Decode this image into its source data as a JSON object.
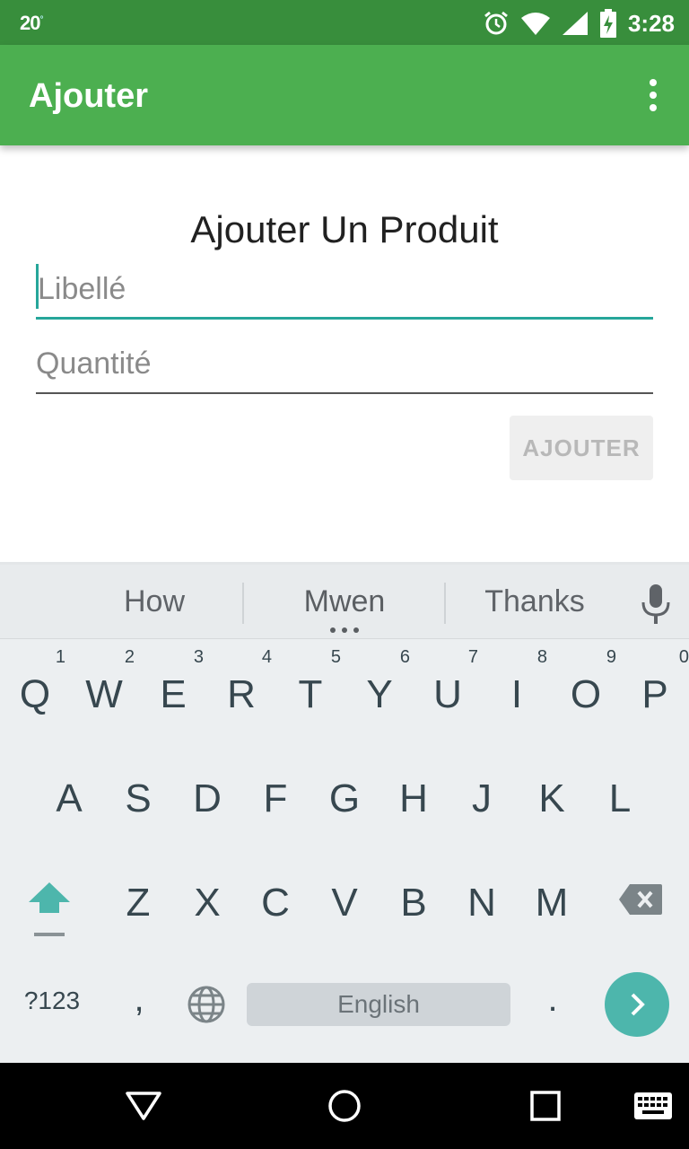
{
  "status_bar": {
    "temperature": "20",
    "degree": "°",
    "time": "3:28",
    "icons": [
      "alarm-icon",
      "wifi-icon",
      "signal-icon",
      "battery-charging-icon"
    ]
  },
  "app_bar": {
    "title": "Ajouter",
    "menu_icon": "more-vertical-icon"
  },
  "form": {
    "heading": "Ajouter Un Produit",
    "libelle": {
      "value": "",
      "placeholder": "Libellé"
    },
    "quantite": {
      "value": "",
      "placeholder": "Quantité"
    },
    "submit_label": "AJOUTER"
  },
  "keyboard": {
    "suggestions": [
      "How",
      "Mwen",
      "Thanks"
    ],
    "row1": [
      {
        "key": "Q",
        "hint": "1"
      },
      {
        "key": "W",
        "hint": "2"
      },
      {
        "key": "E",
        "hint": "3"
      },
      {
        "key": "R",
        "hint": "4"
      },
      {
        "key": "T",
        "hint": "5"
      },
      {
        "key": "Y",
        "hint": "6"
      },
      {
        "key": "U",
        "hint": "7"
      },
      {
        "key": "I",
        "hint": "8"
      },
      {
        "key": "O",
        "hint": "9"
      },
      {
        "key": "P",
        "hint": "0"
      }
    ],
    "row2": [
      "A",
      "S",
      "D",
      "F",
      "G",
      "H",
      "J",
      "K",
      "L"
    ],
    "row3": [
      "Z",
      "X",
      "C",
      "V",
      "B",
      "N",
      "M"
    ],
    "symbols_label": "?123",
    "comma": ",",
    "period": ".",
    "space_label": "English",
    "accent_color": "#4db6ac"
  },
  "colors": {
    "status_bar": "#388e3c",
    "app_bar": "#4caf50",
    "field_focus": "#26a69a"
  },
  "nav_bar": {
    "icons": [
      "back-icon",
      "home-icon",
      "recents-icon",
      "keyboard-switch-icon"
    ]
  }
}
